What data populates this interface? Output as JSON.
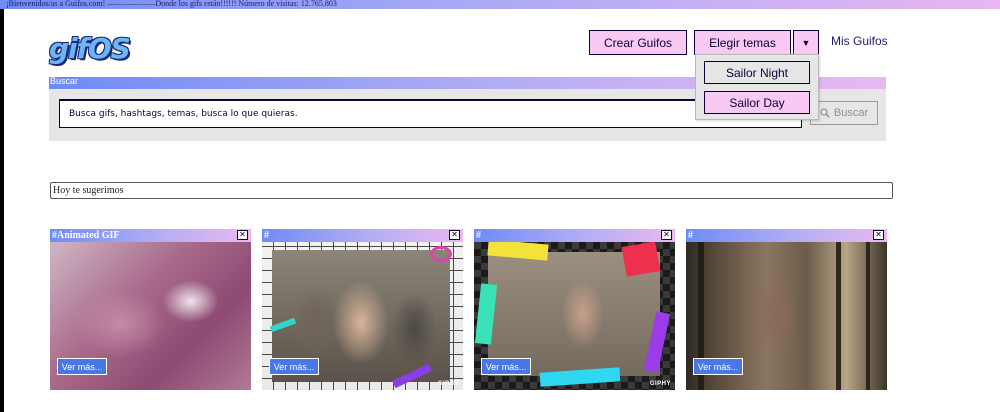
{
  "topbar": {
    "text": "¡Bienvenidos/as a Guifos.com! ——————Donde los gifs están!!!!!! Número de visitas: 12.765.803"
  },
  "logo": {
    "text": "gifOS"
  },
  "header": {
    "crear_label": "Crear Guifos",
    "temas_label": "Elegir temas",
    "caret": "▼",
    "mis_guifos_label": "Mis Guifos"
  },
  "themes_dropdown": {
    "options": [
      "Sailor Night",
      "Sailor Day"
    ]
  },
  "search": {
    "title": "Buscar",
    "placeholder": "Busca gifs, hashtags, temas, busca lo que quieras.",
    "button_label": "Buscar"
  },
  "suggestions": {
    "label": "Hoy te sugerimos",
    "cards": [
      {
        "tag": "#Animated GIF",
        "button": "Ver más...",
        "giphy": ""
      },
      {
        "tag": "#",
        "button": "Ver más...",
        "giphy": "GIPHY"
      },
      {
        "tag": "#",
        "button": "Ver más...",
        "giphy": "GIPHY"
      },
      {
        "tag": "#",
        "button": "Ver más...",
        "giphy": ""
      }
    ]
  },
  "colors": {
    "accent_pink": "#f7c9f3",
    "gradient_start": "#6f8bf7",
    "gradient_end": "#eab8f1",
    "text_dark": "#110038",
    "ver_mas_blue": "#4a77e8"
  }
}
